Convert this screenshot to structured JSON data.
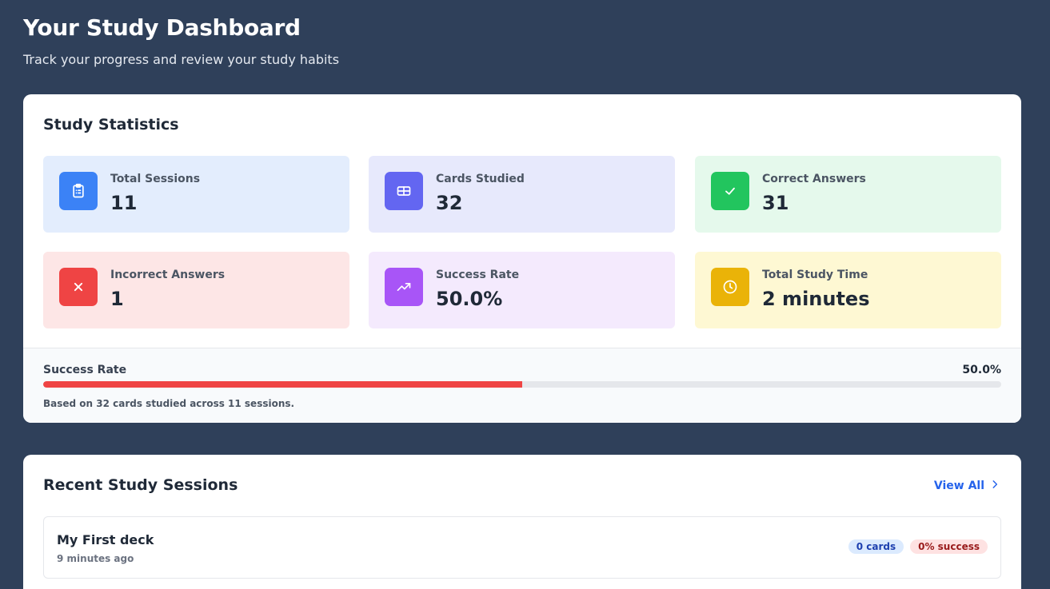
{
  "header": {
    "title": "Your Study Dashboard",
    "subtitle": "Track your progress and review your study habits"
  },
  "stats": {
    "title": "Study Statistics",
    "tiles": [
      {
        "label": "Total Sessions",
        "value": "11",
        "icon": "clipboard-icon",
        "bg": "#e3edfd",
        "icon_bg": "#3b82f6"
      },
      {
        "label": "Cards Studied",
        "value": "32",
        "icon": "cards-icon",
        "bg": "#e7e9fc",
        "icon_bg": "#6366f1"
      },
      {
        "label": "Correct Answers",
        "value": "31",
        "icon": "check-icon",
        "bg": "#e5f9ec",
        "icon_bg": "#22c55e"
      },
      {
        "label": "Incorrect Answers",
        "value": "1",
        "icon": "x-icon",
        "bg": "#fde6e6",
        "icon_bg": "#ef4444"
      },
      {
        "label": "Success Rate",
        "value": "50.0%",
        "icon": "trending-up-icon",
        "bg": "#f4eafd",
        "icon_bg": "#a855f7"
      },
      {
        "label": "Total Study Time",
        "value": "2 minutes",
        "icon": "clock-icon",
        "bg": "#fef8d3",
        "icon_bg": "#eab308"
      }
    ],
    "progress": {
      "label": "Success Rate",
      "value_text": "50.0%",
      "fraction": 0.5,
      "note": "Based on 32 cards studied across 11 sessions."
    }
  },
  "sessions": {
    "title": "Recent Study Sessions",
    "view_all": "View All",
    "items": [
      {
        "title": "My First deck",
        "time": "9 minutes ago",
        "cards_badge": "0 cards",
        "success_badge": "0% success"
      }
    ]
  },
  "colors": {
    "background": "#2f405a",
    "progress_fill": "#ef4444",
    "link": "#2563eb"
  }
}
